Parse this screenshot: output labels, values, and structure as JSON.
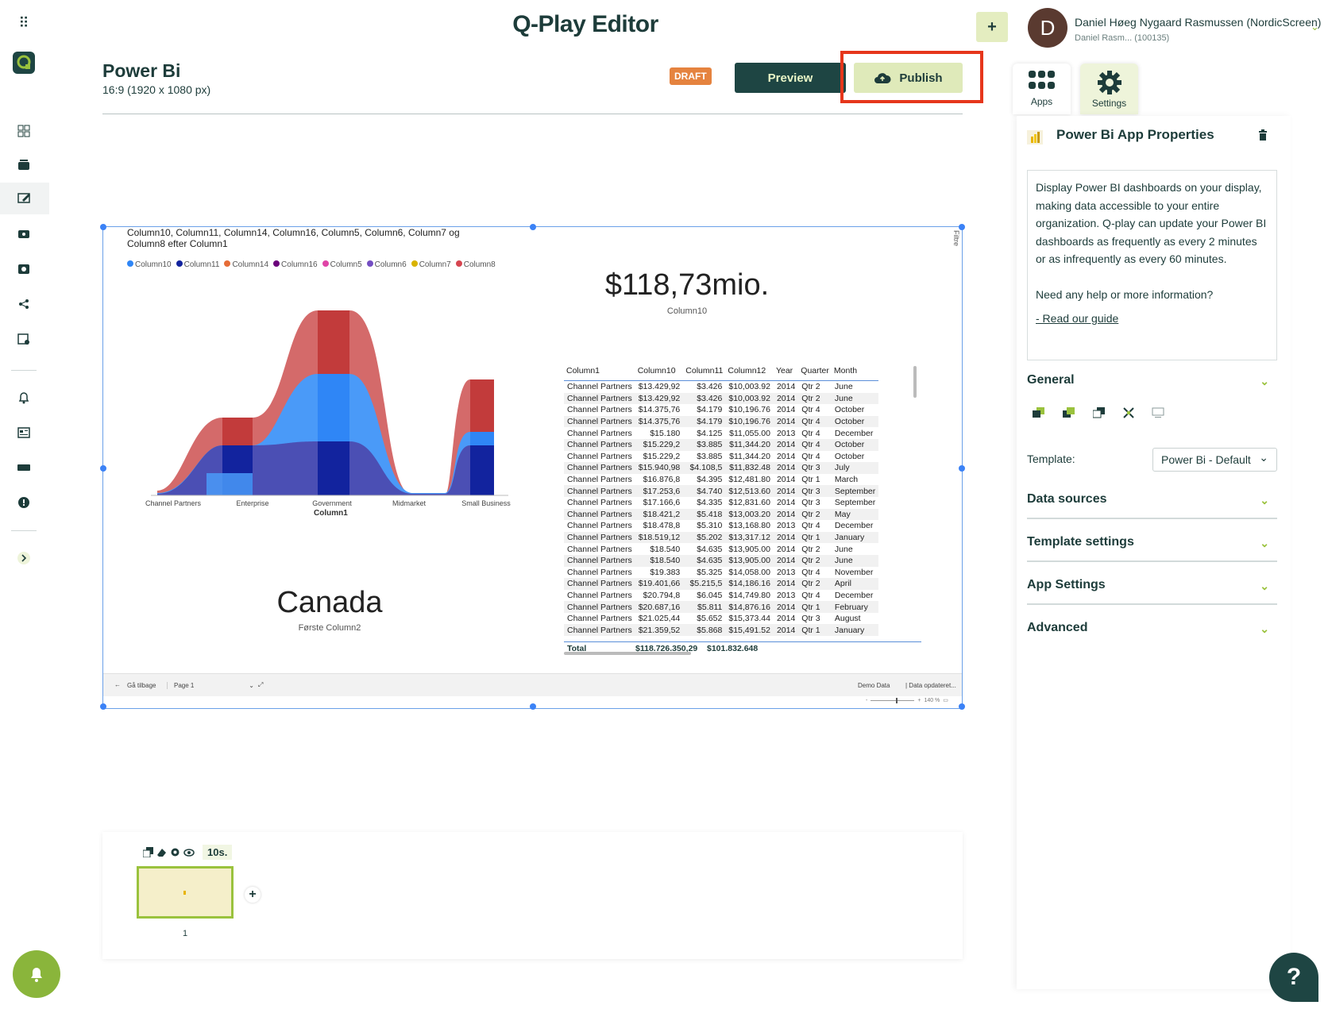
{
  "header": {
    "app_title": "Q-Play Editor",
    "page_name": "Power Bi",
    "page_resolution": "16:9 (1920 x 1080 px)",
    "draft_badge": "DRAFT",
    "preview_label": "Preview",
    "publish_label": "Publish",
    "add_label": "+"
  },
  "user": {
    "initial": "D",
    "name": "Daniel Høeg Nygaard Rasmussen (NordicScreen)",
    "sub": "Daniel Rasm... (100135)"
  },
  "report": {
    "chart_title_line1": "Column10, Column11, Column14, Column16, Column5, Column6, Column7 og",
    "chart_title_line2": "Column8 efter Column1",
    "legend": [
      {
        "name": "Column10",
        "color": "#2f86f6"
      },
      {
        "name": "Column11",
        "color": "#12239e"
      },
      {
        "name": "Column14",
        "color": "#e66c37"
      },
      {
        "name": "Column16",
        "color": "#6b007b"
      },
      {
        "name": "Column5",
        "color": "#e044a7"
      },
      {
        "name": "Column6",
        "color": "#744ec2"
      },
      {
        "name": "Column7",
        "color": "#d9b300"
      },
      {
        "name": "Column8",
        "color": "#d64550"
      }
    ],
    "x_axis_title": "Column1",
    "x_categories": [
      "Channel Partners",
      "Enterprise",
      "Government",
      "Midmarket",
      "Small Business"
    ],
    "kpi_value": "$118,73mio.",
    "kpi_label": "Column10",
    "card_value": "Canada",
    "card_label": "Første Column2",
    "filter_label": "Filtre",
    "table_headers": [
      "Column1",
      "Column10",
      "Column11",
      "Column12",
      "Year",
      "Quarter",
      "Month"
    ],
    "table_rows": [
      [
        "Channel Partners",
        "$13.429,92",
        "$3.426",
        "$10,003.92",
        "2014",
        "Qtr 2",
        "June"
      ],
      [
        "Channel Partners",
        "$13.429,92",
        "$3.426",
        "$10,003.92",
        "2014",
        "Qtr 2",
        "June"
      ],
      [
        "Channel Partners",
        "$14.375,76",
        "$4.179",
        "$10,196.76",
        "2014",
        "Qtr 4",
        "October"
      ],
      [
        "Channel Partners",
        "$14.375,76",
        "$4.179",
        "$10,196.76",
        "2014",
        "Qtr 4",
        "October"
      ],
      [
        "Channel Partners",
        "$15.180",
        "$4.125",
        "$11,055.00",
        "2013",
        "Qtr 4",
        "December"
      ],
      [
        "Channel Partners",
        "$15.229,2",
        "$3.885",
        "$11,344.20",
        "2014",
        "Qtr 4",
        "October"
      ],
      [
        "Channel Partners",
        "$15.229,2",
        "$3.885",
        "$11,344.20",
        "2014",
        "Qtr 4",
        "October"
      ],
      [
        "Channel Partners",
        "$15.940,98",
        "$4.108,5",
        "$11,832.48",
        "2014",
        "Qtr 3",
        "July"
      ],
      [
        "Channel Partners",
        "$16.876,8",
        "$4.395",
        "$12,481.80",
        "2014",
        "Qtr 1",
        "March"
      ],
      [
        "Channel Partners",
        "$17.253,6",
        "$4.740",
        "$12,513.60",
        "2014",
        "Qtr 3",
        "September"
      ],
      [
        "Channel Partners",
        "$17.166,6",
        "$4.335",
        "$12,831.60",
        "2014",
        "Qtr 3",
        "September"
      ],
      [
        "Channel Partners",
        "$18.421,2",
        "$5.418",
        "$13,003.20",
        "2014",
        "Qtr 2",
        "May"
      ],
      [
        "Channel Partners",
        "$18.478,8",
        "$5.310",
        "$13,168.80",
        "2013",
        "Qtr 4",
        "December"
      ],
      [
        "Channel Partners",
        "$18.519,12",
        "$5.202",
        "$13,317.12",
        "2014",
        "Qtr 1",
        "January"
      ],
      [
        "Channel Partners",
        "$18.540",
        "$4.635",
        "$13,905.00",
        "2014",
        "Qtr 2",
        "June"
      ],
      [
        "Channel Partners",
        "$18.540",
        "$4.635",
        "$13,905.00",
        "2014",
        "Qtr 2",
        "June"
      ],
      [
        "Channel Partners",
        "$19.383",
        "$5.325",
        "$14,058.00",
        "2013",
        "Qtr 4",
        "November"
      ],
      [
        "Channel Partners",
        "$19.401,66",
        "$5.215,5",
        "$14,186.16",
        "2014",
        "Qtr 2",
        "April"
      ],
      [
        "Channel Partners",
        "$20.794,8",
        "$6.045",
        "$14,749.80",
        "2013",
        "Qtr 4",
        "December"
      ],
      [
        "Channel Partners",
        "$20.687,16",
        "$5.811",
        "$14,876.16",
        "2014",
        "Qtr 1",
        "February"
      ],
      [
        "Channel Partners",
        "$21.025,44",
        "$5.652",
        "$15,373.44",
        "2014",
        "Qtr 3",
        "August"
      ],
      [
        "Channel Partners",
        "$21.359,52",
        "$5.868",
        "$15,491.52",
        "2014",
        "Qtr 1",
        "January"
      ]
    ],
    "table_total": [
      "Total",
      "$118.726.350,29",
      "$101.832.648"
    ],
    "footer_back": "Gå tilbage",
    "footer_page": "Page 1",
    "footer_demo": "Demo Data",
    "footer_updated": "| Data opdateret...",
    "footer_zoom": "140 %"
  },
  "panel": {
    "tab_apps": "Apps",
    "tab_settings": "Settings",
    "title": "Power Bi App Properties",
    "description": "Display Power BI dashboards on your display, making data accessible to your entire organization. Q-play can update your Power BI dashboards as frequently as every 2 minutes or as infrequently as every 60 minutes.",
    "help_text": "Need any help or more information?",
    "guide_link": "- Read our guide",
    "general": "General",
    "template_label": "Template:",
    "template_value": "Power Bi - Default",
    "data_sources": "Data sources",
    "template_settings": "Template settings",
    "app_settings": "App Settings",
    "advanced": "Advanced"
  },
  "timeline": {
    "duration": "10s.",
    "slide_number": "1",
    "add_slide": "+"
  },
  "help_button": "?"
}
